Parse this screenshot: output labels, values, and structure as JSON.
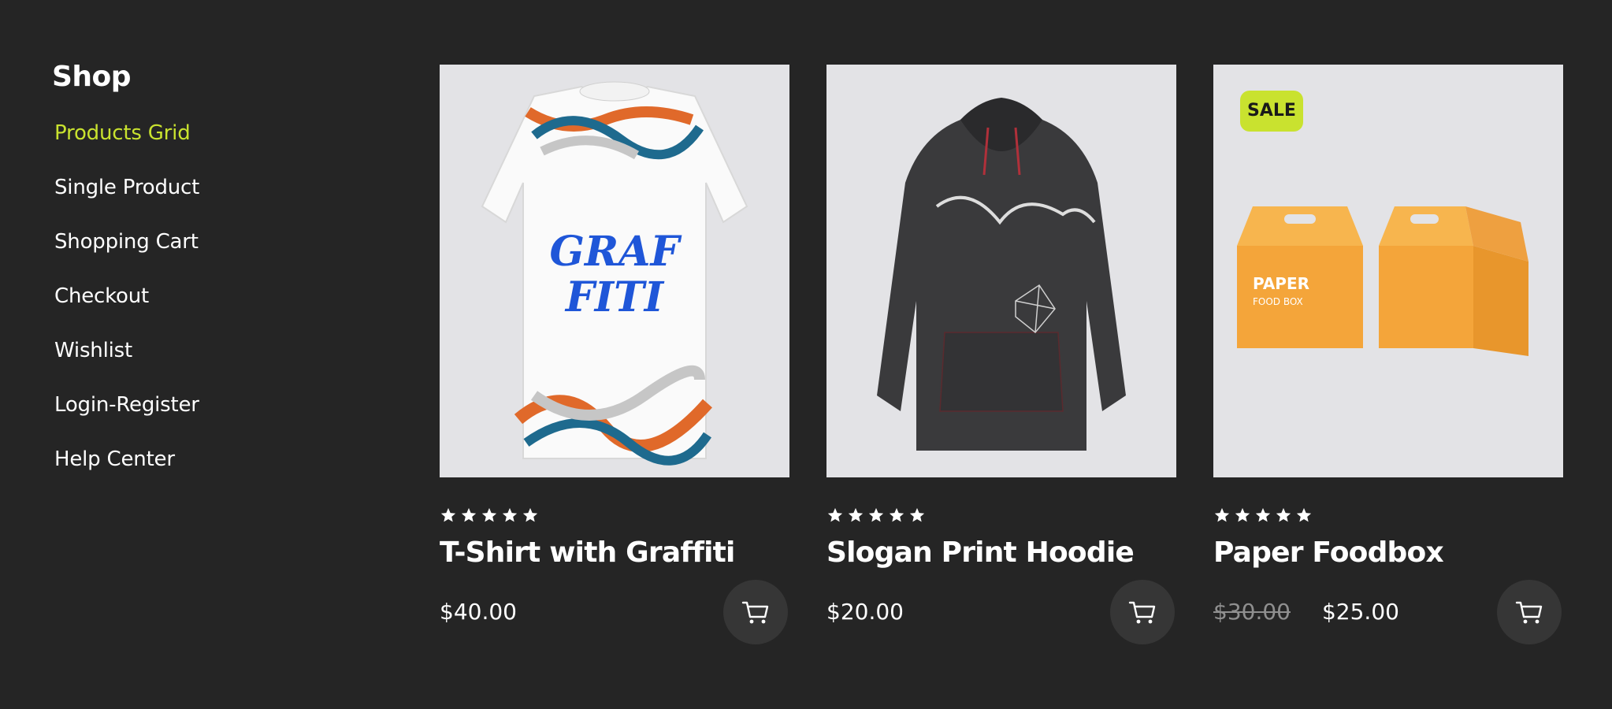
{
  "sidebar": {
    "title": "Shop",
    "items": [
      {
        "label": "Products Grid",
        "active": true
      },
      {
        "label": "Single Product"
      },
      {
        "label": "Shopping Cart"
      },
      {
        "label": "Checkout"
      },
      {
        "label": "Wishlist"
      },
      {
        "label": "Login-Register"
      },
      {
        "label": "Help Center"
      }
    ]
  },
  "products": [
    {
      "name": "T-Shirt with Graffiti",
      "price": "$40.00",
      "rating": 5,
      "image_icon": "tshirt-graffiti-image",
      "image_text": "GRAF FITI"
    },
    {
      "name": "Slogan Print Hoodie",
      "price": "$20.00",
      "rating": 5,
      "image_icon": "hoodie-image"
    },
    {
      "name": "Paper Foodbox",
      "old_price": "$30.00",
      "price": "$25.00",
      "rating": 5,
      "badge": "SALE",
      "image_icon": "paper-foodbox-image",
      "image_text_1": "PAPER",
      "image_text_2": "FOOD BOX"
    }
  ],
  "colors": {
    "background": "#252525",
    "accent": "#c9e22f",
    "image_bg": "#e3e3e6",
    "cart_button_bg": "#363636",
    "old_price": "#8f8f8f"
  },
  "icons": {
    "rating": "star-icon",
    "cart": "cart-icon"
  }
}
